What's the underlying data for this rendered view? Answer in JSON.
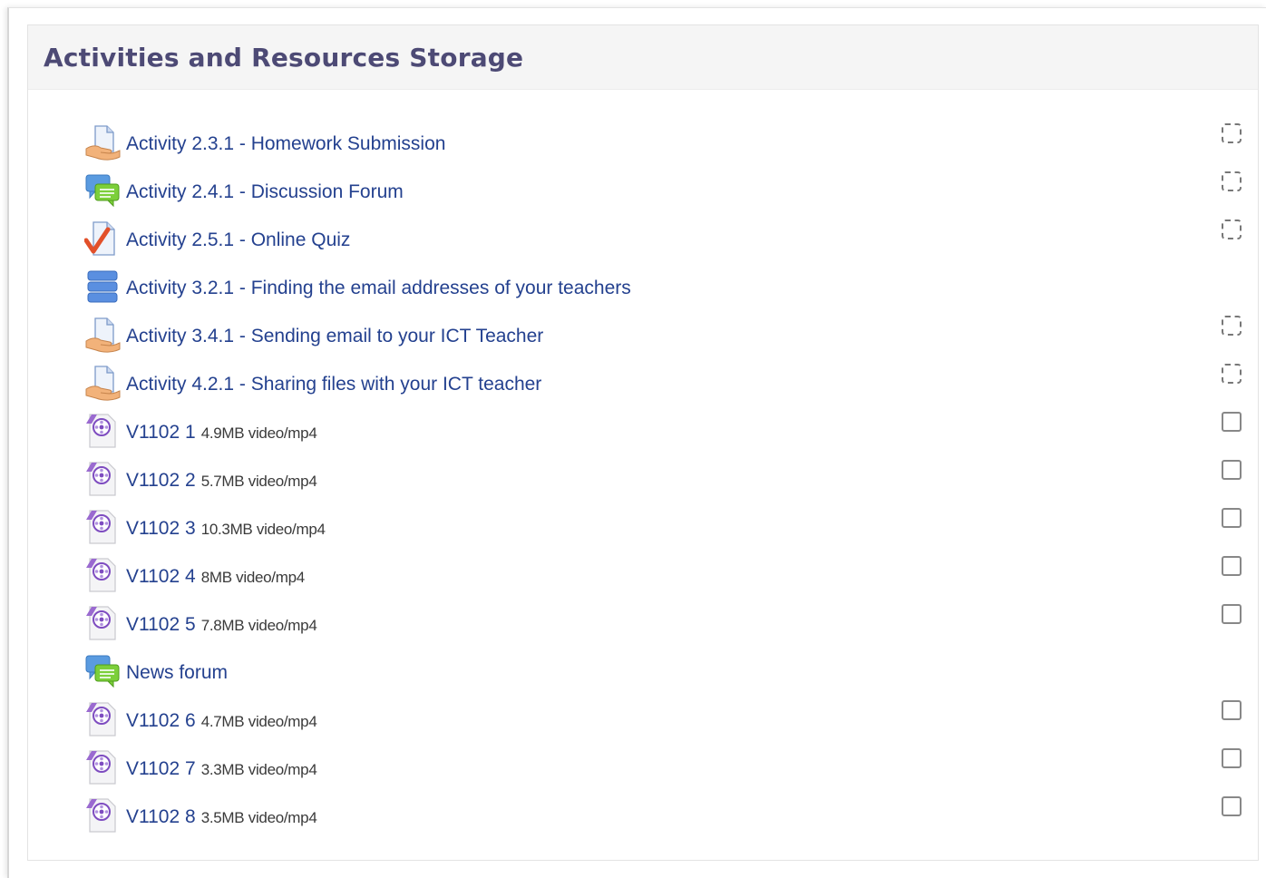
{
  "panel": {
    "title": "Activities and Resources Storage"
  },
  "items": [
    {
      "label": "Activity 2.3.1 - Homework Submission",
      "meta": "",
      "icon": "assignment-icon",
      "completion": "auto"
    },
    {
      "label": "Activity 2.4.1 - Discussion Forum",
      "meta": "",
      "icon": "forum-icon",
      "completion": "auto"
    },
    {
      "label": "Activity 2.5.1 - Online Quiz",
      "meta": "",
      "icon": "quiz-icon",
      "completion": "auto"
    },
    {
      "label": "Activity 3.2.1 - Finding the email addresses of your teachers",
      "meta": "",
      "icon": "database-icon",
      "completion": "none"
    },
    {
      "label": "Activity 3.4.1 - Sending email to your ICT Teacher",
      "meta": "",
      "icon": "assignment-icon",
      "completion": "auto"
    },
    {
      "label": "Activity 4.2.1 - Sharing files with your ICT teacher",
      "meta": "",
      "icon": "assignment-icon",
      "completion": "auto"
    },
    {
      "label": "V1102 1",
      "meta": "4.9MB video/mp4",
      "icon": "video-file-icon",
      "completion": "manual"
    },
    {
      "label": "V1102 2",
      "meta": "5.7MB video/mp4",
      "icon": "video-file-icon",
      "completion": "manual"
    },
    {
      "label": "V1102 3",
      "meta": "10.3MB video/mp4",
      "icon": "video-file-icon",
      "completion": "manual"
    },
    {
      "label": "V1102 4",
      "meta": "8MB video/mp4",
      "icon": "video-file-icon",
      "completion": "manual"
    },
    {
      "label": "V1102 5",
      "meta": "7.8MB video/mp4",
      "icon": "video-file-icon",
      "completion": "manual"
    },
    {
      "label": "News forum",
      "meta": "",
      "icon": "forum-icon",
      "completion": "none"
    },
    {
      "label": "V1102 6",
      "meta": "4.7MB video/mp4",
      "icon": "video-file-icon",
      "completion": "manual"
    },
    {
      "label": "V1102 7",
      "meta": "3.3MB video/mp4",
      "icon": "video-file-icon",
      "completion": "manual"
    },
    {
      "label": "V1102 8",
      "meta": "3.5MB video/mp4",
      "icon": "video-file-icon",
      "completion": "manual"
    }
  ],
  "colors": {
    "title": "#4d4a75",
    "link": "#24418f",
    "header_bg": "#f5f5f5"
  }
}
